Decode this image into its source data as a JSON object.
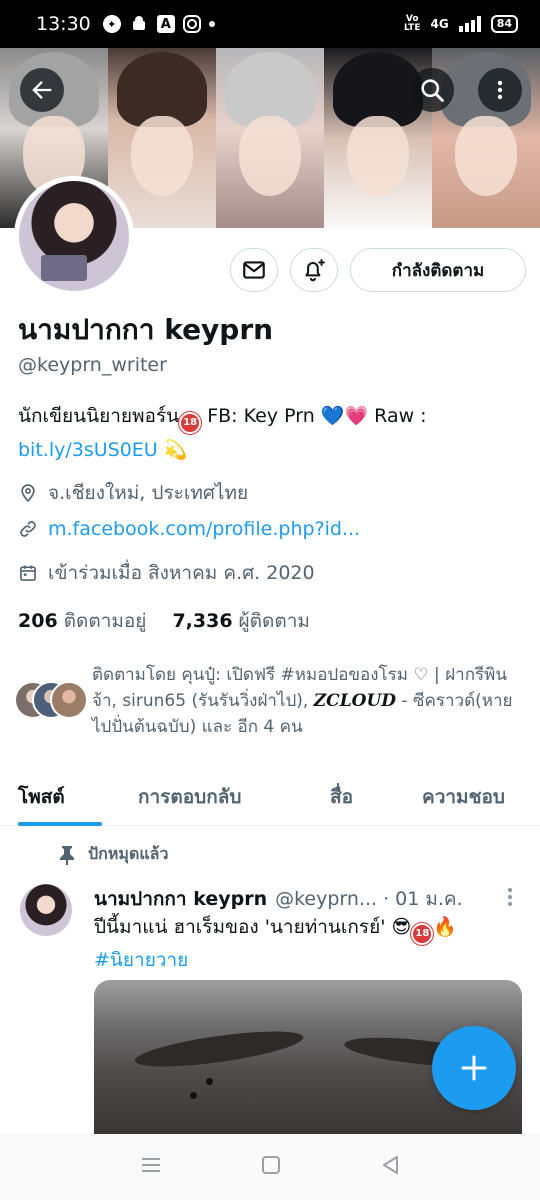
{
  "status_bar": {
    "time": "13:30",
    "network": "4G",
    "volte": "VoLTE",
    "battery": "84"
  },
  "header": {
    "back_icon": "arrow-left-icon",
    "search_icon": "search-icon",
    "more_icon": "more-vertical-icon"
  },
  "profile": {
    "display_name": "นามปากกา keyprn",
    "handle": "@keyprn_writer",
    "bio_text_1": "นักเขียนนิยายพอร์น",
    "bio_badge": "18",
    "bio_text_2": " FB: Key Prn ",
    "bio_hearts": [
      "💙",
      "💗"
    ],
    "bio_text_3": " Raw :",
    "bio_link": "bit.ly/3sUS0EU",
    "bio_emoji_end": "💫",
    "location": "จ.เชียงใหม่, ประเทศไทย",
    "website": "m.facebook.com/profile.php?id...",
    "joined": "เข้าร่วมเมื่อ สิงหาคม ค.ศ. 2020",
    "following_count": "206",
    "following_label": "ติดตามอยู่",
    "followers_count": "7,336",
    "followers_label": "ผู้ติดตาม",
    "following_button": "กำลังติดตาม",
    "followed_by_prefix": "ติดตามโดย คุนปู๋: เปิดฟรี #หมอปอของโรม ♡ | ฝากรีพินจ้า, sirun65 (รันรันวิ่งฝ่าไป), ",
    "followed_by_italic": "ZCLOUD",
    "followed_by_suffix": " - ซีคราวด์(หายไปปั่นต้นฉบับ) และ อีก 4 คน"
  },
  "tabs": [
    {
      "label": "โพสต์",
      "active": true
    },
    {
      "label": "การตอบกลับ",
      "active": false
    },
    {
      "label": "สื่อ",
      "active": false
    },
    {
      "label": "ความชอบ",
      "active": false
    }
  ],
  "pinned_label": "ปักหมุดแล้ว",
  "tweet": {
    "name": "นามปากกา keyprn",
    "handle": "@keyprn...",
    "date": "01 ม.ค.",
    "text": "ปีนี้มาแน่ ฮาเร็มของ 'นายท่านเกรย์' ",
    "emojis": [
      "😎",
      "🔥"
    ],
    "badge": "18",
    "hashtag": "#นิยายวาย"
  },
  "colors": {
    "accent": "#1d9bf0",
    "text": "#0f1419",
    "muted": "#536471",
    "border": "#cfd9de"
  }
}
